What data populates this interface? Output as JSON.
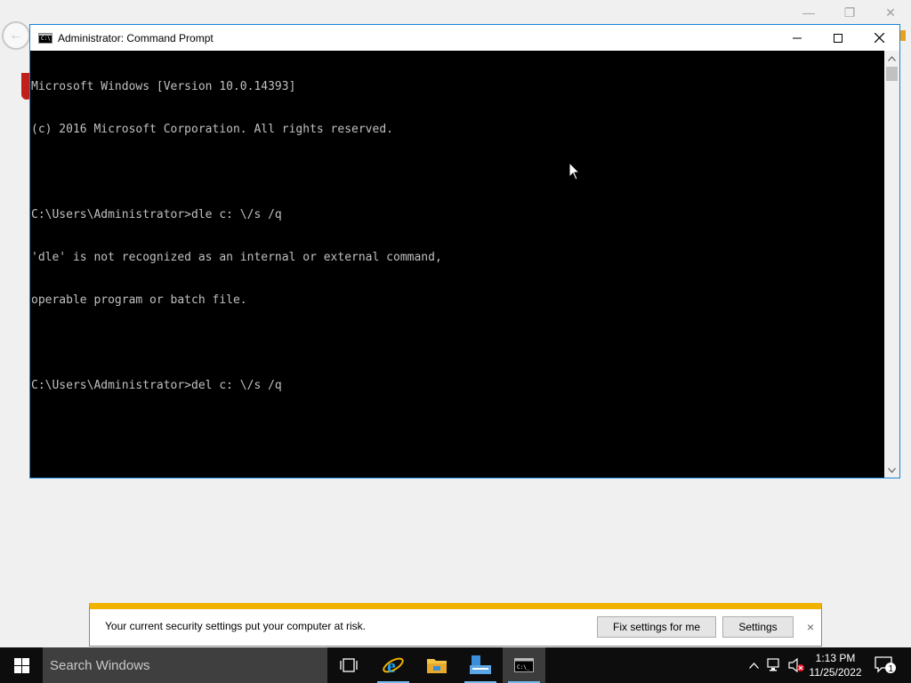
{
  "window": {
    "title": "Administrator: Command Prompt",
    "icon": "cmd-icon",
    "minimize_glyph": "—",
    "maximize_glyph": "☐",
    "close_glyph": "✕"
  },
  "console": {
    "lines": [
      "Microsoft Windows [Version 10.0.14393]",
      "(c) 2016 Microsoft Corporation. All rights reserved.",
      "",
      "C:\\Users\\Administrator>dle c: \\/s /q",
      "'dle' is not recognized as an internal or external command,",
      "operable program or batch file.",
      "",
      "C:\\Users\\Administrator>del c: \\/s /q"
    ],
    "background": "#000000",
    "foreground": "#c0c0c0"
  },
  "notification": {
    "message": "Your current security settings put your computer at risk.",
    "fix_button": "Fix settings for me",
    "settings_button": "Settings",
    "close_glyph": "×",
    "accent": "#f2b200"
  },
  "taskbar": {
    "search_placeholder": "Search Windows",
    "apps": [
      "task-view",
      "internet-explorer",
      "file-explorer",
      "server-manager",
      "command-prompt"
    ],
    "active_app": "command-prompt",
    "clock_time": "1:13 PM",
    "clock_date": "11/25/2022",
    "notification_count": "1"
  },
  "colors": {
    "window_border": "#1883d7",
    "taskbar": "#0d0d0d",
    "accent_underline": "#76b9ed"
  }
}
